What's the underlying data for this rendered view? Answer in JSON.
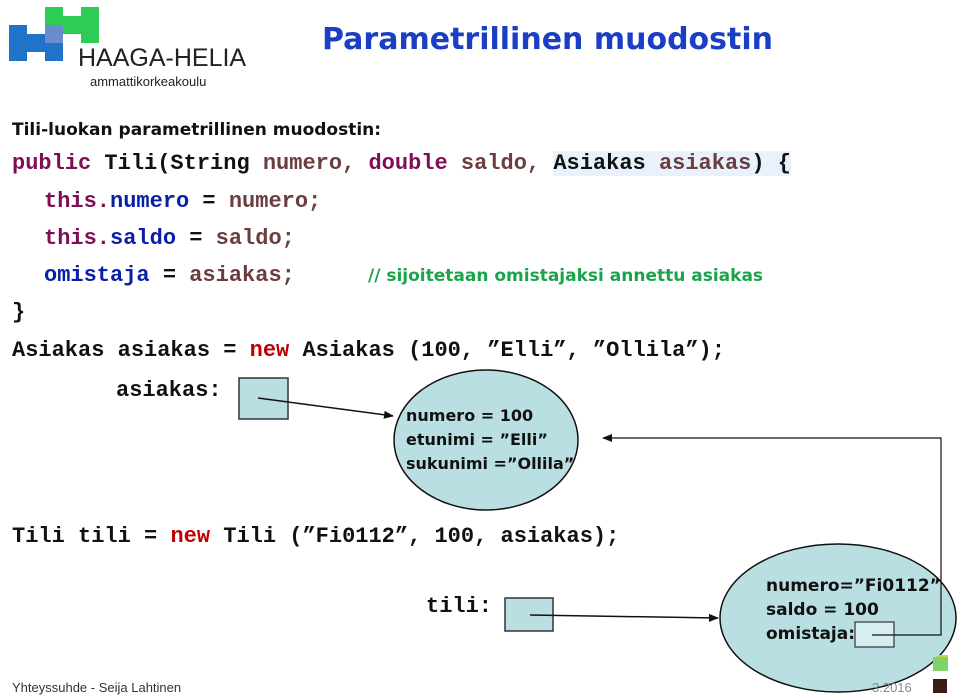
{
  "logo": {
    "name": "HAAGA-HELIA",
    "subtitle": "ammattikorkeakoulu"
  },
  "title": "Parametrillinen muodostin",
  "intro": "Tili-luokan parametrillinen muodostin:",
  "code": {
    "signature": {
      "public": "public",
      "class": "Tili(String",
      "p1": "numero,",
      "double": "double",
      "p2": "saldo,",
      "type3": "Asiakas",
      "p3": "asiakas",
      "end": ") {"
    },
    "line1": {
      "this": "this.",
      "field": "numero",
      "eq": " = ",
      "val": "numero;"
    },
    "line2": {
      "this": "this.",
      "field": "saldo",
      "eq": " = ",
      "val": "saldo;"
    },
    "line3": {
      "field": "omistaja",
      "eq": " = ",
      "val": "asiakas;"
    },
    "comment": "// sijoitetaan omistajaksi annettu asiakas",
    "close": "}",
    "asiakas_stmt": {
      "pre": "Asiakas asiakas = ",
      "new": "new",
      "post": " Asiakas (100, ”Elli”, ”Ollila”);"
    },
    "tili_stmt": {
      "pre": "Tili tili = ",
      "new": "new",
      "post": " Tili (”Fi0112”, 100, asiakas);"
    }
  },
  "diagram": {
    "asiakas_label": "asiakas:",
    "asiakas_object": [
      "numero = 100",
      "etunimi = ”Elli”",
      "sukunimi =”Ollila”"
    ],
    "tili_label": "tili:",
    "tili_object": [
      "numero=”Fi0112”",
      "saldo = 100",
      "omistaja:"
    ]
  },
  "footer": {
    "left": "Yhteyssuhde - Seija Lahtinen",
    "right": "3.2016"
  },
  "colors": {
    "title": "#1a3fc4",
    "object_fill": "#b9dfe3",
    "comment": "#1aa44a",
    "keyword_new": "#c00000"
  }
}
